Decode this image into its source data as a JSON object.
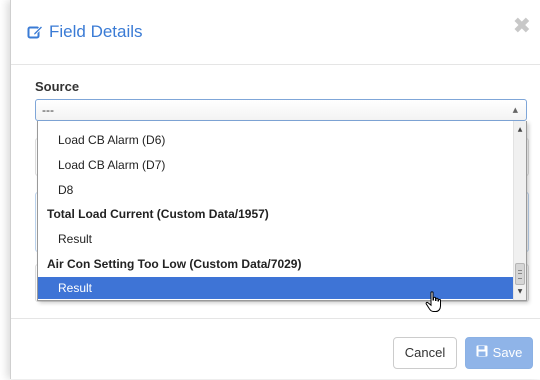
{
  "modal": {
    "title": "Field Details",
    "title_icon": "edit-icon",
    "close_icon": "✖"
  },
  "source": {
    "label": "Source",
    "selected_value": "---",
    "arrow": "▲"
  },
  "dropdown": {
    "items": [
      {
        "type": "option",
        "label": "Load CB Alarm (D6)"
      },
      {
        "type": "option",
        "label": "Load CB Alarm (D7)"
      },
      {
        "type": "option",
        "label": "D8"
      },
      {
        "type": "group",
        "label": "Total Load Current (Custom Data/1957)"
      },
      {
        "type": "option",
        "label": "Result"
      },
      {
        "type": "group",
        "label": "Air Con Setting Too Low (Custom Data/7029)"
      },
      {
        "type": "option",
        "label": "Result",
        "selected": true
      }
    ],
    "scroll_up": "▲",
    "scroll_down": "▼"
  },
  "footer": {
    "cancel_label": "Cancel",
    "save_label": "Save",
    "save_icon": "save-icon"
  },
  "colors": {
    "accent": "#3a7bd5",
    "selected_bg": "#3e74d6",
    "save_bg": "#8fb4e8"
  }
}
